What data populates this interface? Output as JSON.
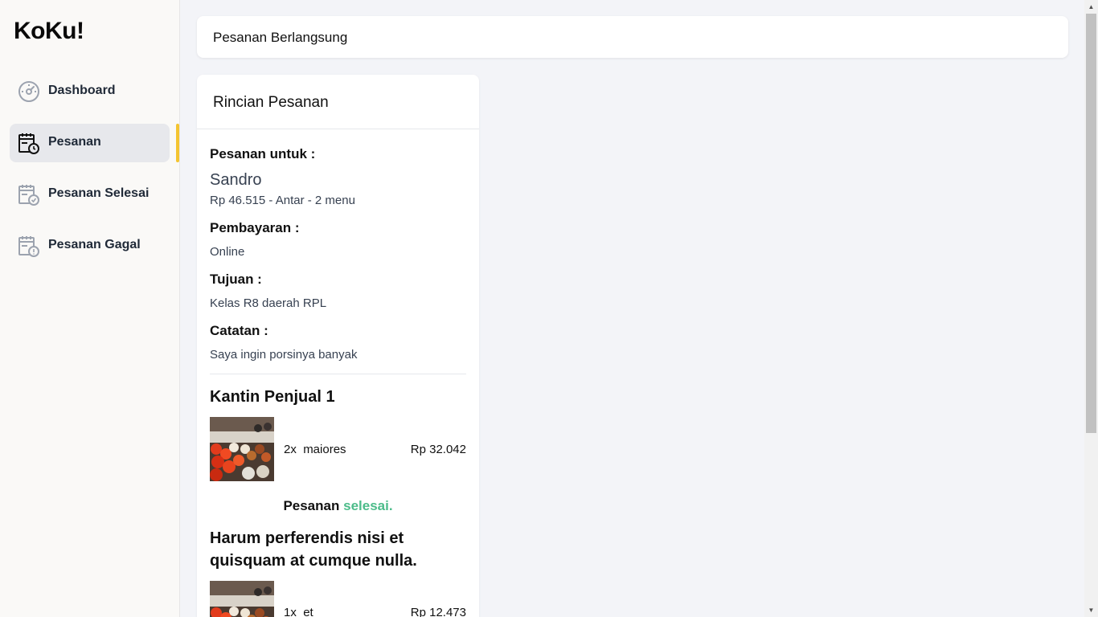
{
  "app": {
    "brand": "KoKu!"
  },
  "sidebar": {
    "items": [
      {
        "label": "Dashboard",
        "icon": "dashboard-gauge-icon",
        "active": false
      },
      {
        "label": "Pesanan",
        "icon": "order-calendar-clock-icon",
        "active": true
      },
      {
        "label": "Pesanan Selesai",
        "icon": "order-calendar-check-icon",
        "active": false
      },
      {
        "label": "Pesanan Gagal",
        "icon": "order-calendar-alert-icon",
        "active": false
      }
    ],
    "active_indicator_color": "#f4c430"
  },
  "header": {
    "title": "Pesanan Berlangsung"
  },
  "order": {
    "card_title": "Rincian Pesanan",
    "for_label": "Pesanan untuk :",
    "customer_name": "Sandro",
    "summary": "Rp 46.515 - Antar - 2 menu",
    "payment_label": "Pembayaran :",
    "payment_value": "Online",
    "destination_label": "Tujuan :",
    "destination_value": "Kelas R8 daerah RPL",
    "note_label": "Catatan :",
    "note_value": "Saya ingin porsinya banyak",
    "groups": [
      {
        "seller": "Kantin Penjual 1",
        "items": [
          {
            "qty": "2x",
            "name": "maiores",
            "price": "Rp 32.042"
          }
        ],
        "status_prefix": "Pesanan",
        "status_word": "selesai."
      },
      {
        "seller": "Harum perferendis nisi et quisquam at cumque nulla.",
        "items": [
          {
            "qty": "1x",
            "name": "et",
            "price": "Rp 12.473"
          }
        ]
      }
    ],
    "status_color": "#4cbc8a"
  }
}
